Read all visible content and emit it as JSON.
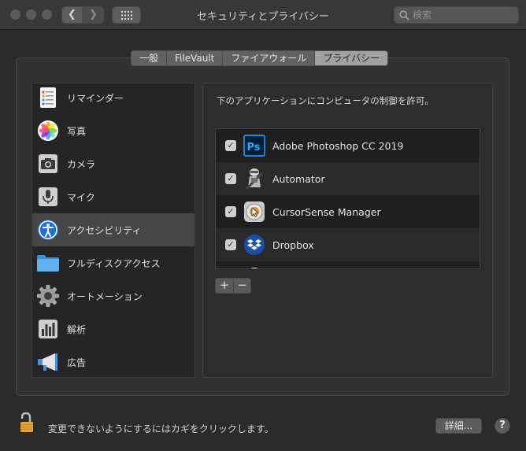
{
  "window": {
    "title": "セキュリティとプライバシー",
    "search_placeholder": "検索"
  },
  "tabs": [
    {
      "label": "一般",
      "active": false
    },
    {
      "label": "FileVault",
      "active": false
    },
    {
      "label": "ファイアウォール",
      "active": false
    },
    {
      "label": "プライバシー",
      "active": true
    }
  ],
  "sidebar": {
    "items": [
      {
        "label": "リマインダー",
        "icon": "reminders-icon",
        "selected": false
      },
      {
        "label": "写真",
        "icon": "photos-icon",
        "selected": false
      },
      {
        "label": "カメラ",
        "icon": "camera-icon",
        "selected": false
      },
      {
        "label": "マイク",
        "icon": "microphone-icon",
        "selected": false
      },
      {
        "label": "アクセシビリティ",
        "icon": "accessibility-icon",
        "selected": true
      },
      {
        "label": "フルディスクアクセス",
        "icon": "folder-icon",
        "selected": false
      },
      {
        "label": "オートメーション",
        "icon": "gear-icon",
        "selected": false
      },
      {
        "label": "解析",
        "icon": "analytics-icon",
        "selected": false
      },
      {
        "label": "広告",
        "icon": "megaphone-icon",
        "selected": false
      }
    ]
  },
  "content": {
    "description": "下のアプリケーションにコンピュータの制御を許可。",
    "apps": [
      {
        "name": "Adobe Photoshop CC 2019",
        "checked": true,
        "icon": "photoshop-icon"
      },
      {
        "name": "Automator",
        "checked": true,
        "icon": "automator-icon"
      },
      {
        "name": "CursorSense Manager",
        "checked": true,
        "icon": "cursorsense-icon"
      },
      {
        "name": "Dropbox",
        "checked": true,
        "icon": "dropbox-icon"
      }
    ],
    "add_label": "+",
    "remove_label": "−"
  },
  "footer": {
    "lock_message": "変更できないようにするにはカギをクリックします。",
    "detail_button": "詳細...",
    "help_button": "?"
  },
  "colors": {
    "window_bg": "#2b2b2b",
    "selected_row": "#464646",
    "photoshop_blue": "#31a8ff",
    "dropbox_blue": "#0061fe",
    "lock_gold": "#e1a43a"
  }
}
